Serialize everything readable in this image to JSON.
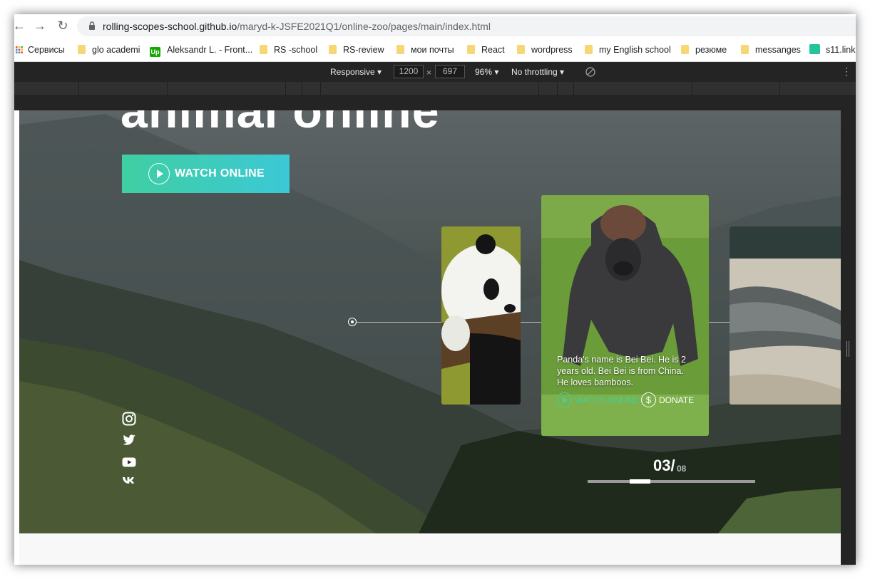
{
  "browser": {
    "url_host": "rolling-scopes-school.github.io",
    "url_path": "/maryd-k-JSFE2021Q1/online-zoo/pages/main/index.html",
    "bookmarks": [
      "Сервисы",
      "glo academi",
      "Aleksandr L. - Front...",
      "RS -school",
      "RS-review",
      "мои почты",
      "React",
      "wordpress",
      "my English school",
      "резюме",
      "messanges",
      "s11.link"
    ]
  },
  "devtools": {
    "device": "Responsive",
    "width": "1200",
    "height": "697",
    "zoom": "96%",
    "throttling": "No throttling"
  },
  "hero": {
    "title": "animal online",
    "watch_label": "WATCH ONLINE"
  },
  "social_icons": [
    "instagram-icon",
    "twitter-icon",
    "youtube-icon",
    "vk-icon"
  ],
  "active_card": {
    "description": "Panda's name is Bei Bei. He is 2 years old. Bei Bei is from China. He loves bamboos.",
    "watch_label": "WATCH ONLINE",
    "donate_label": "DONATE",
    "donate_symbol": "$"
  },
  "pager": {
    "current": "03/",
    "total": "08",
    "progress_fraction": 0.375
  },
  "colors": {
    "accent": "#3fd1a0",
    "button_gradient_end": "#3cc8d6"
  }
}
